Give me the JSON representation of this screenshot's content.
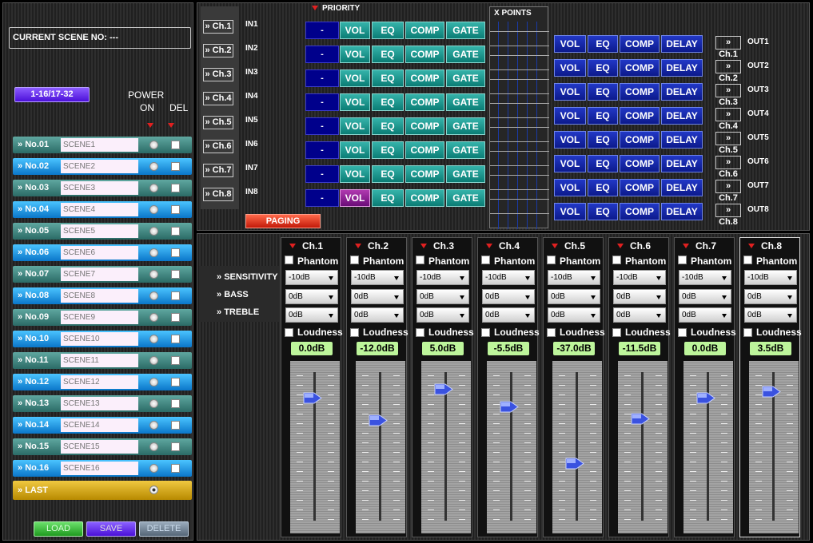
{
  "scene": {
    "label": "CURRENT SCENE NO:",
    "value": "---"
  },
  "range_button": "1-16/17-32",
  "power_label": "POWER",
  "on_label": "ON",
  "del_label": "DEL",
  "scenes": [
    {
      "no": "No.01",
      "name": "SCENE1"
    },
    {
      "no": "No.02",
      "name": "SCENE2"
    },
    {
      "no": "No.03",
      "name": "SCENE3"
    },
    {
      "no": "No.04",
      "name": "SCENE4"
    },
    {
      "no": "No.05",
      "name": "SCENE5"
    },
    {
      "no": "No.06",
      "name": "SCENE6"
    },
    {
      "no": "No.07",
      "name": "SCENE7"
    },
    {
      "no": "No.08",
      "name": "SCENE8"
    },
    {
      "no": "No.09",
      "name": "SCENE9"
    },
    {
      "no": "No.10",
      "name": "SCENE10"
    },
    {
      "no": "No.11",
      "name": "SCENE11"
    },
    {
      "no": "No.12",
      "name": "SCENE12"
    },
    {
      "no": "No.13",
      "name": "SCENE13"
    },
    {
      "no": "No.14",
      "name": "SCENE14"
    },
    {
      "no": "No.15",
      "name": "SCENE15"
    },
    {
      "no": "No.16",
      "name": "SCENE16"
    }
  ],
  "last_label": "LAST",
  "actions": {
    "load": "LOAD",
    "save": "SAVE",
    "delete": "DELETE"
  },
  "priority_label": "PRIORITY",
  "paging_label": "PAGING",
  "xpoints_label": "X POINTS",
  "input_channels": [
    {
      "ch": "Ch.1",
      "in": "IN1",
      "prio": "-"
    },
    {
      "ch": "Ch.2",
      "in": "IN2",
      "prio": "-"
    },
    {
      "ch": "Ch.3",
      "in": "IN3",
      "prio": "-"
    },
    {
      "ch": "Ch.4",
      "in": "IN4",
      "prio": "-"
    },
    {
      "ch": "Ch.5",
      "in": "IN5",
      "prio": "-"
    },
    {
      "ch": "Ch.6",
      "in": "IN6",
      "prio": "-"
    },
    {
      "ch": "Ch.7",
      "in": "IN7",
      "prio": "-"
    },
    {
      "ch": "Ch.8",
      "in": "IN8",
      "prio": "-"
    }
  ],
  "input_buttons": [
    "VOL",
    "EQ",
    "COMP",
    "GATE"
  ],
  "output_channels": [
    {
      "ch": "Ch.1",
      "out": "OUT1"
    },
    {
      "ch": "Ch.2",
      "out": "OUT2"
    },
    {
      "ch": "Ch.3",
      "out": "OUT3"
    },
    {
      "ch": "Ch.4",
      "out": "OUT4"
    },
    {
      "ch": "Ch.5",
      "out": "OUT5"
    },
    {
      "ch": "Ch.6",
      "out": "OUT6"
    },
    {
      "ch": "Ch.7",
      "out": "OUT7"
    },
    {
      "ch": "Ch.8",
      "out": "OUT8"
    }
  ],
  "output_buttons": [
    "VOL",
    "EQ",
    "COMP",
    "DELAY"
  ],
  "sensitivity_label": "SENSITIVITY",
  "bass_label": "BASS",
  "treble_label": "TREBLE",
  "phantom_label": "Phantom",
  "loudness_label": "Loudness",
  "strips": [
    {
      "name": "Ch.1",
      "sensitivity": "-10dB",
      "bass": "0dB",
      "treble": "0dB",
      "gain": "0.0dB",
      "level": 0.83
    },
    {
      "name": "Ch.2",
      "sensitivity": "-10dB",
      "bass": "0dB",
      "treble": "0dB",
      "gain": "-12.0dB",
      "level": 0.68
    },
    {
      "name": "Ch.3",
      "sensitivity": "-10dB",
      "bass": "0dB",
      "treble": "0dB",
      "gain": "5.0dB",
      "level": 0.89
    },
    {
      "name": "Ch.4",
      "sensitivity": "-10dB",
      "bass": "0dB",
      "treble": "0dB",
      "gain": "-5.5dB",
      "level": 0.77
    },
    {
      "name": "Ch.5",
      "sensitivity": "-10dB",
      "bass": "0dB",
      "treble": "0dB",
      "gain": "-37.0dB",
      "level": 0.39
    },
    {
      "name": "Ch.6",
      "sensitivity": "-10dB",
      "bass": "0dB",
      "treble": "0dB",
      "gain": "-11.5dB",
      "level": 0.69
    },
    {
      "name": "Ch.7",
      "sensitivity": "-10dB",
      "bass": "0dB",
      "treble": "0dB",
      "gain": "0.0dB",
      "level": 0.83
    },
    {
      "name": "Ch.8",
      "sensitivity": "-10dB",
      "bass": "0dB",
      "treble": "0dB",
      "gain": "3.5dB",
      "level": 0.87
    }
  ]
}
